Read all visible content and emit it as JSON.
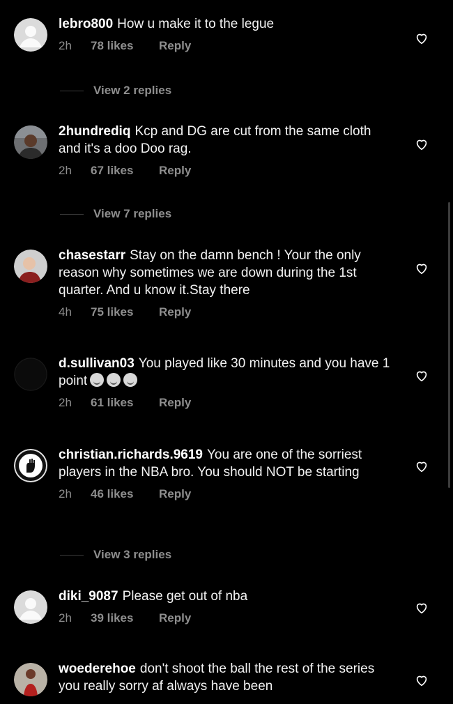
{
  "comments": [
    {
      "username": "lebro800",
      "text": "How u make it to the legue",
      "time": "2h",
      "likes": "78 likes",
      "reply": "Reply",
      "view_replies": "View 2 replies",
      "avatar": "default-avatar"
    },
    {
      "username": "2hundrediq",
      "text": "Kcp and DG are cut from the same cloth and it's a doo Doo rag.",
      "time": "2h",
      "likes": "67 likes",
      "reply": "Reply",
      "view_replies": "View 7 replies",
      "avatar": "photo-avatar"
    },
    {
      "username": "chasestarr",
      "text": "Stay on the damn bench ! Your the only reason why sometimes we are down during the 1st quarter. And u know it.Stay there",
      "time": "4h",
      "likes": "75 likes",
      "reply": "Reply",
      "avatar": "photo-avatar"
    },
    {
      "username": "d.sullivan03",
      "text": "You played like 30 minutes and you have 1 point",
      "emojis": [
        "face-with-tears-of-joy-emoji",
        "face-with-tears-of-joy-emoji",
        "face-with-tears-of-joy-emoji"
      ],
      "time": "2h",
      "likes": "61 likes",
      "reply": "Reply",
      "avatar": "dark-avatar"
    },
    {
      "username": "christian.richards.9619",
      "text": "You are one of the sorriest players in the NBA bro. You should NOT be starting",
      "time": "2h",
      "likes": "46 likes",
      "reply": "Reply",
      "view_replies": "View 3 replies",
      "avatar": "raised-fist-avatar"
    },
    {
      "username": "diki_9087",
      "text": "Please get out of nba",
      "time": "2h",
      "likes": "39 likes",
      "reply": "Reply",
      "avatar": "default-avatar"
    },
    {
      "username": "woederehoe",
      "text": "don't shoot the ball the rest of the series you really sorry af always have been",
      "avatar": "photo-avatar"
    }
  ],
  "icons": {
    "like": "heart-outline-icon"
  },
  "colors": {
    "background": "#000000",
    "text": "#ffffff",
    "meta": "#8e8e8e"
  }
}
